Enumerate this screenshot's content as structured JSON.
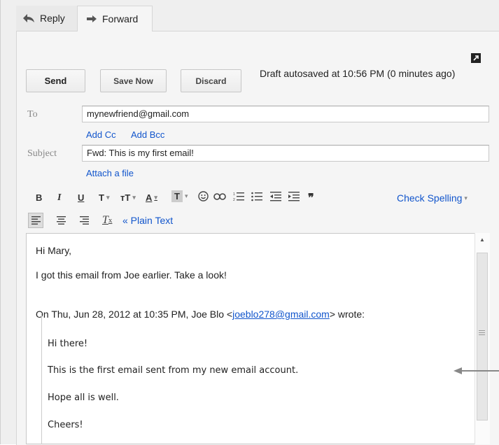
{
  "tabs": {
    "reply_label": "Reply",
    "forward_label": "Forward"
  },
  "toolbar": {
    "send_label": "Send",
    "save_label": "Save Now",
    "discard_label": "Discard",
    "autosave_text": "Draft autosaved at 10:56 PM (0 minutes ago)"
  },
  "compose": {
    "to_label": "To",
    "to_value": "mynewfriend@gmail.com",
    "add_cc": "Add Cc",
    "add_bcc": "Add Bcc",
    "subject_label": "Subject",
    "subject_value": "Fwd: This is my first email!",
    "attach": "Attach a file"
  },
  "format": {
    "bold": "B",
    "italic": "I",
    "underline": "U",
    "font": "T",
    "size": "тT",
    "color": "A",
    "highlight": "T",
    "check_spelling": "Check Spelling",
    "plain_text": "« Plain Text"
  },
  "body": {
    "greeting": "Hi Mary,",
    "line1": "I got this email from Joe earlier. Take a look!",
    "quote_header_pre": "On Thu, Jun 28, 2012 at 10:35 PM, Joe Blo <",
    "quote_email": "joeblo278@gmail.com",
    "quote_header_post": "> wrote:",
    "quoted": [
      "Hi there!",
      "This is the first email sent from my new email account.",
      "Hope all is well.",
      "Cheers!"
    ]
  }
}
